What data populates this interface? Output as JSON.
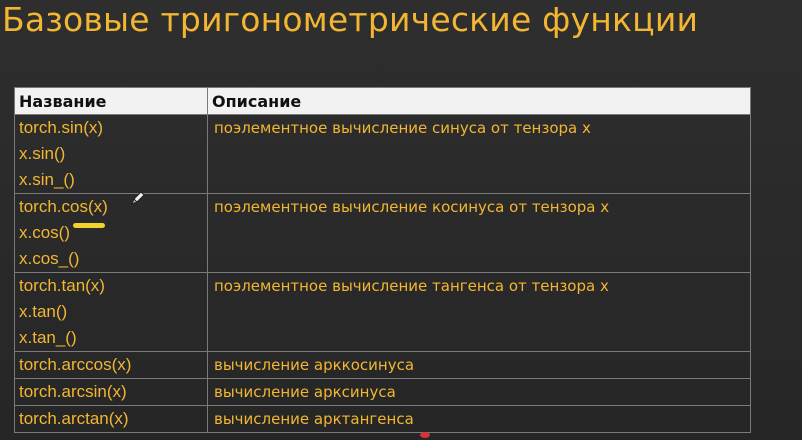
{
  "slide": {
    "title": "Базовые тригонометрические функции"
  },
  "table": {
    "headers": {
      "name": "Название",
      "description": "Описание"
    },
    "rows": [
      {
        "names": [
          "torch.sin(x)",
          "x.sin()",
          "x.sin_()"
        ],
        "description": "поэлементное вычисление синуса от тензора x"
      },
      {
        "names": [
          "torch.cos(x)",
          "x.cos()",
          "x.cos_()"
        ],
        "description": "поэлементное вычисление косинуса от тензора x"
      },
      {
        "names": [
          "torch.tan(x)",
          "x.tan()",
          "x.tan_()"
        ],
        "description": "поэлементное вычисление тангенса от тензора x"
      },
      {
        "names": [
          "torch.arccos(x)"
        ],
        "description": "вычисление арккосинуса"
      },
      {
        "names": [
          "torch.arcsin(x)"
        ],
        "description": "вычисление арксинуса"
      },
      {
        "names": [
          "torch.arctan(x)"
        ],
        "description": "вычисление арктангенса"
      }
    ]
  },
  "annotations": {
    "underline_color": "#f2d22c",
    "pen_icon": "pen-cursor-icon",
    "pointer_dot_color": "#d4343b"
  },
  "colors": {
    "accent": "#f2b632",
    "background": "#2b2b2b",
    "header_bg": "#f2f2f2"
  }
}
